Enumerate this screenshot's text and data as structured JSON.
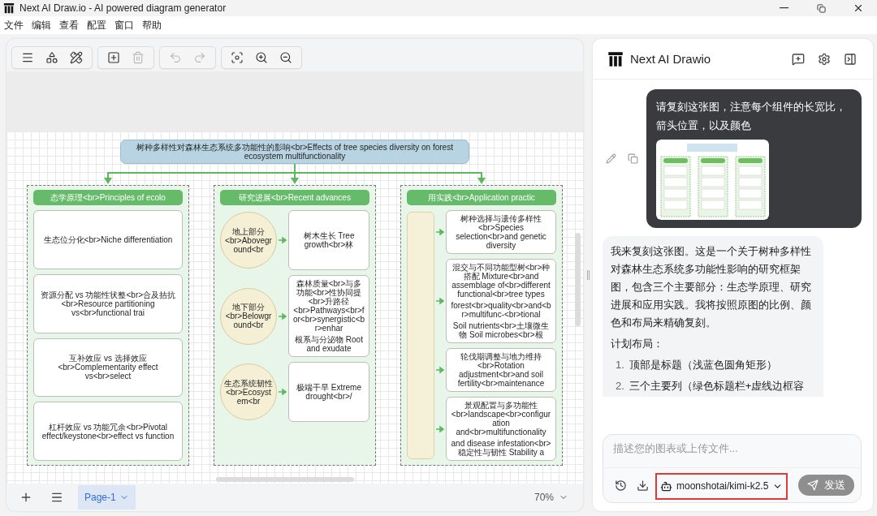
{
  "window": {
    "title": "Next AI Draw.io - AI powered diagram generator"
  },
  "menu": [
    "文件",
    "编辑",
    "查看",
    "配置",
    "窗口",
    "帮助"
  ],
  "toolbar": [
    {
      "buttons": [
        {
          "kind": "menu",
          "disabled": false
        },
        {
          "kind": "shapes",
          "disabled": false
        },
        {
          "kind": "tools",
          "disabled": false
        }
      ]
    },
    {
      "buttons": [
        {
          "kind": "add",
          "disabled": false
        },
        {
          "kind": "delete",
          "disabled": true
        }
      ]
    },
    {
      "buttons": [
        {
          "kind": "undo",
          "disabled": true
        },
        {
          "kind": "redo",
          "disabled": true
        }
      ]
    },
    {
      "buttons": [
        {
          "kind": "fit",
          "disabled": false
        },
        {
          "kind": "zoom-in",
          "disabled": false
        },
        {
          "kind": "zoom-out",
          "disabled": false
        }
      ]
    }
  ],
  "diagram": {
    "title": "树种多样性对森林生态系统多功能性的影响<br>Effects of tree species diversity on forest ecosystem multifunctionality",
    "columns": [
      {
        "kind": "boxes",
        "header": "态学原理<br>Principles of ecolo",
        "rows": [
          {
            "labels": [
              "生态位分化<br>Niche differentiation"
            ]
          },
          {
            "labels": [
              "资源分配 vs 功能性状整<br>合及拮抗<br>Resource partitioning vs<br>functional trai"
            ]
          },
          {
            "labels": [
              "互补效应 vs 选择效应<br>Complementarity effect vs<br>select"
            ]
          },
          {
            "labels": [
              "杠杆效应 vs 功能冗余<br>Pivotal effect/keystone<br>effect vs function"
            ]
          }
        ]
      },
      {
        "kind": "circles",
        "header": "研究进展<br>Recent advances",
        "rows": [
          {
            "circle": "地上部分<br>Aboveground<br",
            "labels": [
              "树木生长 Tree growth<br>林"
            ]
          },
          {
            "circle": "地下部分<br>Belowground<br",
            "labels": [
              "森林质量<br>与多功能<br>性协同提<br>升路径<br>Pathways<br>for<br>synergistic<br>enhar",
              "根系与分泌物 Root and exudate"
            ]
          },
          {
            "circle": "生态系统韧性<br>Ecosystem<br",
            "labels": [
              "极端干旱 Extreme drought<br>/"
            ]
          }
        ]
      },
      {
        "kind": "bar",
        "header": "用实践<br>Application practic",
        "rows": [
          {
            "labels": [
              "树种选择与遗传多样性<br>Species selection<br>and genetic diversity"
            ]
          },
          {
            "labels": [
              "混交与不同功能型树<br>种搭配 Mixture<br>and assemblage of<br>different functional<br>tree types",
              "forest<br>quality<br>and<br>multifunc-<br>tional",
              "Soil nutrients<br>土壤微生物 Soil microbes<br>根"
            ]
          },
          {
            "labels": [
              "轮伐期调整与地力维持<br>Rotation adjustment<br>and soil fertility<br>maintenance"
            ]
          },
          {
            "labels": [
              "景观配置与多功能性<br>landscape<br>configuration and<br>multifunctionality",
              "and disease infestation<br>稳定性与韧性 Stability a"
            ]
          }
        ]
      }
    ]
  },
  "pages": {
    "tabs": [
      {
        "label": "Page-1",
        "selected": true
      }
    ],
    "zoom": "70%"
  },
  "chat": {
    "brand": "Next AI Drawio",
    "messages": [
      {
        "kind": "user",
        "text": "请复刻这张图，注意每个组件的长宽比，箭头位置，以及颜色",
        "has_image": true
      },
      {
        "kind": "assistant",
        "paragraphs": [
          "我来复刻这张图。这是一个关于树种多样性对森林生态系统多功能性影响的研究框架图，包含三个主要部分：生态学原理、研究进展和应用实践。我将按照原图的比例、颜色和布局来精确复刻。",
          "计划布局："
        ],
        "list": [
          {
            "number": "1.",
            "text": "顶部是标题（浅蓝色圆角矩形）"
          },
          {
            "number": "2.",
            "text": "三个主要列（绿色标题栏+虚线边框容"
          }
        ]
      }
    ],
    "input": {
      "placeholder": "描述您的图表或上传文件..."
    },
    "model": {
      "name": "moonshotai/kimi-k2.5",
      "highlighted": true
    },
    "send": {
      "label": "发送",
      "disabled": true
    }
  }
}
